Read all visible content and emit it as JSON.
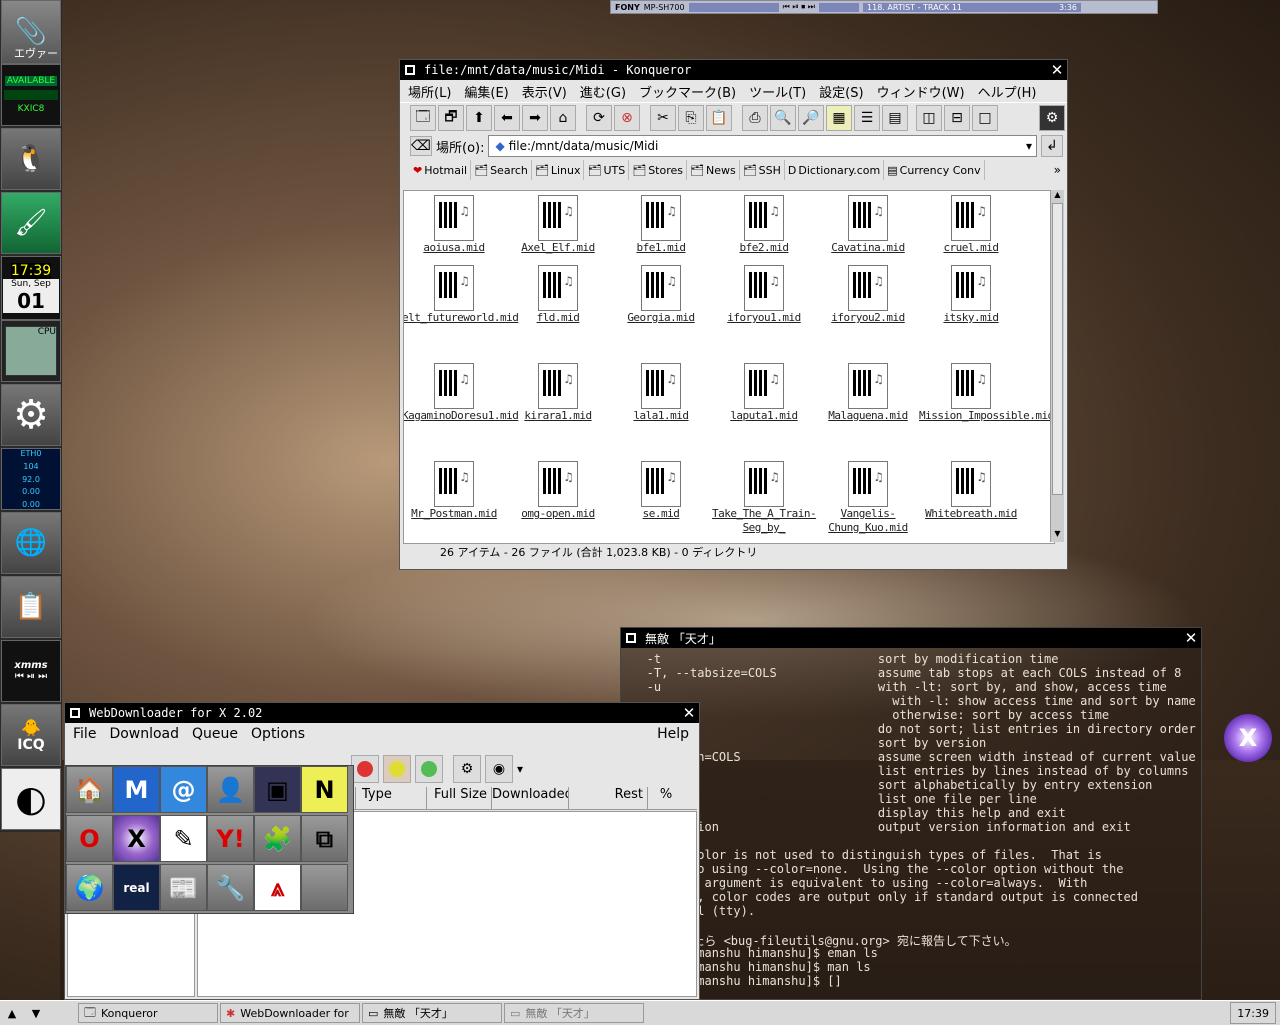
{
  "player": {
    "brand": "FONY",
    "model": "MP-SH700",
    "track": "118. ARTIST - TRACK 11",
    "time": "3:36"
  },
  "dock": {
    "label_evangelion": "エヴァー",
    "status": "AVAILABLE",
    "code": "KXIC8",
    "clock_time": "17:39",
    "date_day": "Sun, Sep",
    "date_num": "01",
    "cpu_label": "CPU",
    "net_label": "ETH0",
    "net_rx": "104",
    "net_tx": "92.0",
    "net_a": "0.00",
    "net_b": "0.00",
    "xmms": "xmms",
    "icq": "ICQ"
  },
  "konqueror": {
    "title": "file:/mnt/data/music/Midi - Konqueror",
    "menu": [
      "場所(L)",
      "編集(E)",
      "表示(V)",
      "進む(G)",
      "ブックマーク(B)",
      "ツール(T)",
      "設定(S)",
      "ウィンドウ(W)",
      "ヘルプ(H)"
    ],
    "location_label": "場所(o):",
    "location_value": "file:/mnt/data/music/Midi",
    "bookmarks": [
      "Hotmail",
      "Search",
      "Linux",
      "UTS",
      "Stores",
      "News",
      "SSH",
      "Dictionary.com",
      "Currency Conv"
    ],
    "files": [
      "aoiusa.mid",
      "Axel_Elf.mid",
      "bfe1.mid",
      "bfe2.mid",
      "Cavatina.mid",
      "cruel.mid",
      "elt_futureworld.mid",
      "fld.mid",
      "Georgia.mid",
      "iforyou1.mid",
      "iforyou2.mid",
      "itsky.mid",
      "KagaminoDoresu1.mid",
      "kirara1.mid",
      "lala1.mid",
      "laputa1.mid",
      "Malaguena.mid",
      "Mission_Impossible.mid",
      "Mr_Postman.mid",
      "omg-open.mid",
      "se.mid",
      "Take_The_A_Train-Seg_by_",
      "Vangelis-Chung_Kuo.mid",
      "Whitebreath.mid"
    ],
    "status": "26 アイテム - 26 ファイル (合計 1,023.8 KB) - 0 ディレクトリ"
  },
  "terminal": {
    "title": "無敵 「天才」",
    "lines": [
      "   -t                              sort by modification time",
      "   -T, --tabsize=COLS              assume tab stops at each COLS instead of 8",
      "   -u                              with -lt: sort by, and show, access time",
      "                                     with -l: show access time and sort by name",
      "                                     otherwise: sort by access time",
      "                                   do not sort; list entries in directory order",
      "                                   sort by version",
      "      width=COLS                   assume screen width instead of current value",
      "                                   list entries by lines instead of by columns",
      "                                   sort alphabetically by entry extension",
      "                                   list one file per line",
      "      help                         display this help and exit",
      "      version                      output version information and exit",
      "",
      "      t, color is not used to distinguish types of files.  That is",
      "      nt to using --color=none.  Using the --color option without the",
      "      WHEN argument is equivalent to using --color=always.  With",
      "      auto, color codes are output only if standard output is connected",
      "      minal (tty).",
      "",
      "      見したら <bug-fileutils@gnu.org> 宛に報告して下さい。",
      "      u@himanshu himanshu]$ eman ls",
      "      u@himanshu himanshu]$ man ls",
      "      u@himanshu himanshu]$ []"
    ]
  },
  "webdownloader": {
    "title": "WebDownloader for X 2.02",
    "menu": [
      "File",
      "Download",
      "Queue",
      "Options"
    ],
    "help": "Help",
    "columns": [
      "Type",
      "Full Size",
      "Downloaded",
      "Rest",
      "%"
    ]
  },
  "taskbar": {
    "tasks": [
      "Konqueror",
      "WebDownloader for",
      "無敵 「天才」",
      "無敵 「天才」"
    ],
    "clock": "17:39"
  },
  "colors": {
    "titlebar": "#000000",
    "window_bg": "#e6e6e6",
    "terminal_text": "#e8e2d6"
  }
}
